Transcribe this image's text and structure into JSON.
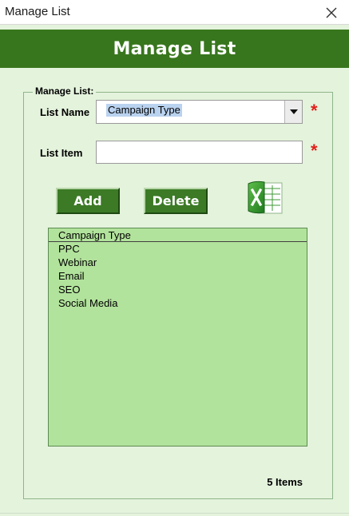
{
  "window": {
    "title": "Manage List",
    "close_icon": "close-icon"
  },
  "banner": {
    "title": "Manage List"
  },
  "form": {
    "group_label": "Manage List:",
    "list_name_label": "List Name",
    "list_name_value": "Campaign Type",
    "list_item_label": "List Item",
    "list_item_value": "",
    "required_mark": "*",
    "required_color": "#e0201b"
  },
  "buttons": {
    "add": "Add",
    "delete": "Delete",
    "export_icon": "excel-icon"
  },
  "list": {
    "header": "Campaign Type",
    "items": [
      "PPC",
      "Webinar",
      "Email",
      "SEO",
      "Social Media"
    ]
  },
  "status": {
    "count_text": "5 Items"
  },
  "colors": {
    "accent": "#38761d",
    "list_bg": "#b2e39c",
    "panel_bg": "#e4f3dc"
  }
}
